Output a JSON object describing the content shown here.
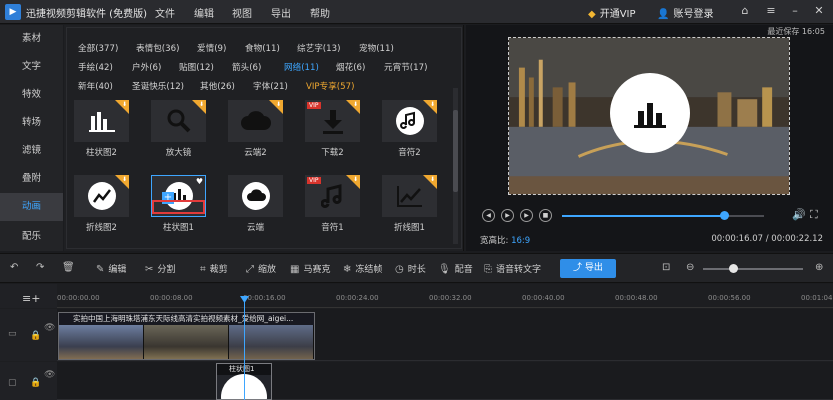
{
  "app": {
    "title": "迅捷视频剪辑软件 (免费版)",
    "menu": [
      "文件",
      "编辑",
      "视图",
      "导出",
      "帮助"
    ],
    "vip_label": "开通VIP",
    "account_label": "账号登录"
  },
  "sidebar": {
    "items": [
      {
        "label": "素材"
      },
      {
        "label": "文字"
      },
      {
        "label": "特效"
      },
      {
        "label": "转场"
      },
      {
        "label": "滤镜"
      },
      {
        "label": "叠附"
      },
      {
        "label": "动画"
      },
      {
        "label": "配乐"
      }
    ],
    "active": "动画"
  },
  "library": {
    "categories": [
      [
        "全部(377)",
        "表情包(36)",
        "爱情(9)",
        "食物(11)",
        "综艺字(13)",
        "宠物(11)"
      ],
      [
        "手绘(42)",
        "户外(6)",
        "贴图(12)",
        "箭头(6)",
        "网络(11)",
        "烟花(6)",
        "元宵节(17)"
      ],
      [
        "新年(40)",
        "圣诞快乐(12)",
        "其他(26)",
        "字体(21)",
        "VIP专享(57)"
      ]
    ],
    "active_category": "网络(11)",
    "items": [
      {
        "label": "柱状图2",
        "icon": "bar-chart-icon"
      },
      {
        "label": "放大镜",
        "icon": "magnifier-icon"
      },
      {
        "label": "云端2",
        "icon": "cloud-icon"
      },
      {
        "label": "下载2",
        "icon": "download-icon"
      },
      {
        "label": "音符2",
        "icon": "music-note-icon"
      },
      {
        "label": "折线图2",
        "icon": "line-chart-icon"
      },
      {
        "label": "柱状图1",
        "icon": "bar-chart-icon"
      },
      {
        "label": "云端",
        "icon": "cloud-icon"
      },
      {
        "label": "音符1",
        "icon": "music-note-icon"
      },
      {
        "label": "折线图1",
        "icon": "line-chart-icon"
      }
    ],
    "badge_vip": "VIP"
  },
  "preview": {
    "status": "最近保存 16:05",
    "ratio_label": "宽高比:",
    "ratio_value": "16:9",
    "current_time": "00:00:16.07",
    "total_time": "00:00:22.12",
    "progress": 0.8
  },
  "toolbar": {
    "tools": [
      "编辑",
      "分割",
      "裁剪",
      "缩放",
      "马赛克",
      "冻结帧",
      "时长",
      "配音",
      "语音转文字"
    ],
    "export_label": "导出",
    "zoom": 0.3
  },
  "timeline": {
    "ticks": [
      "00:00:00.00",
      "00:00:08.00",
      "00:00:16.00",
      "00:00:24.00",
      "00:00:32.00",
      "00:00:40.00",
      "00:00:48.00",
      "00:00:56.00",
      "00:01:04.00"
    ],
    "video_clip_title": "实拍中国上海明珠塔浦东天际线高清实拍视频素材_爱给网_aigei...",
    "effect_clip_title": "柱状图1"
  },
  "colors": {
    "accent": "#3ea6ff",
    "vip": "#f0a830",
    "export": "#2f8ee8"
  }
}
